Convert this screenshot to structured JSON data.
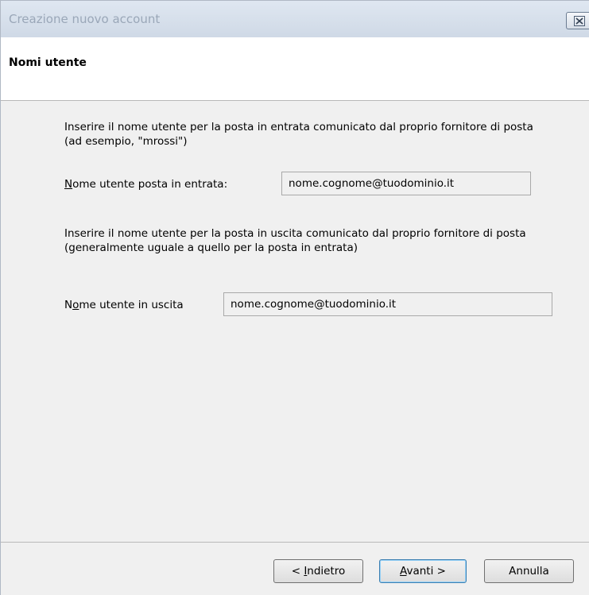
{
  "window": {
    "title": "Creazione nuovo account"
  },
  "header": {
    "title": "Nomi utente"
  },
  "incoming": {
    "description": "Inserire il nome utente per la posta in entrata comunicato dal proprio fornitore di posta (ad esempio, \"mrossi\")",
    "label_accel": "N",
    "label_rest": "ome utente posta in entrata:",
    "value": "nome.cognome@tuodominio.it"
  },
  "outgoing": {
    "description": "Inserire il nome utente per la posta in uscita comunicato dal proprio fornitore di posta (generalmente uguale a quello per la posta in entrata)",
    "label_pre": "N",
    "label_accel": "o",
    "label_rest": "me utente in uscita",
    "value": "nome.cognome@tuodominio.it"
  },
  "buttons": {
    "back_pre": "< ",
    "back_accel": "I",
    "back_rest": "ndietro",
    "next_accel": "A",
    "next_rest": "vanti >",
    "cancel": "Annulla"
  },
  "icons": {
    "close": "close-icon"
  }
}
